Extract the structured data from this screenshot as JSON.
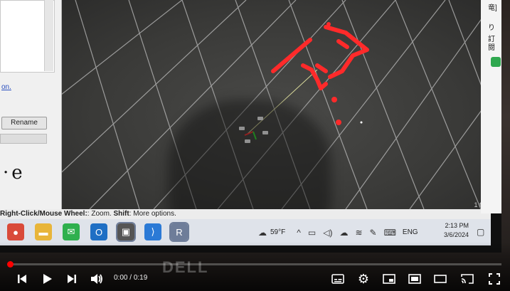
{
  "left_panel": {
    "link_text": "on.",
    "rename_label": "Rename",
    "logo_text": "·e"
  },
  "status_bar": {
    "hint_key": "Right-Click/Mouse Wheel:",
    "hint_action": ": Zoom.",
    "shift_key": "Shift",
    "shift_action": ": More options."
  },
  "viewport": {
    "fps_label": "1 fps"
  },
  "right_strip": {
    "text_1": "竜]",
    "text_2": "り",
    "text_3": "訂閱"
  },
  "taskbar": {
    "apps": [
      {
        "name": "chrome-icon",
        "color": "#d94a3a"
      },
      {
        "name": "file-explorer-icon",
        "color": "#e8b53a"
      },
      {
        "name": "line-icon",
        "color": "#2fb04e"
      },
      {
        "name": "outlook-icon",
        "color": "#1f6fc4"
      },
      {
        "name": "photos-icon",
        "color": "#555555"
      },
      {
        "name": "vscode-icon",
        "color": "#2b7ad6"
      },
      {
        "name": "rviz-icon",
        "color": "#6e7d99"
      }
    ],
    "weather_temp": "59°F",
    "language": "ENG",
    "time": "2:13 PM",
    "date": "3/6/2024"
  },
  "player": {
    "time_current": "0:00",
    "time_separator": " / ",
    "time_total": "0:19",
    "progress_fraction": 0.0,
    "watermark": "DELL",
    "accent_color": "#ff0000"
  }
}
